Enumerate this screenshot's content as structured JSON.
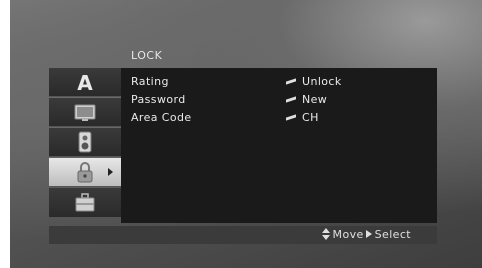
{
  "menu": {
    "title": "LOCK"
  },
  "sidebar": {
    "items": [
      {
        "icon": "letter-a-icon",
        "label": "A"
      },
      {
        "icon": "tv-icon"
      },
      {
        "icon": "speaker-icon"
      },
      {
        "icon": "lock-icon",
        "selected": true
      },
      {
        "icon": "briefcase-icon"
      }
    ]
  },
  "settings": [
    {
      "label": "Rating",
      "value": "Unlock"
    },
    {
      "label": "Password",
      "value": "New"
    },
    {
      "label": "Area Code",
      "value": "CH"
    }
  ],
  "footer": {
    "move_label": "Move",
    "select_label": "Select"
  }
}
